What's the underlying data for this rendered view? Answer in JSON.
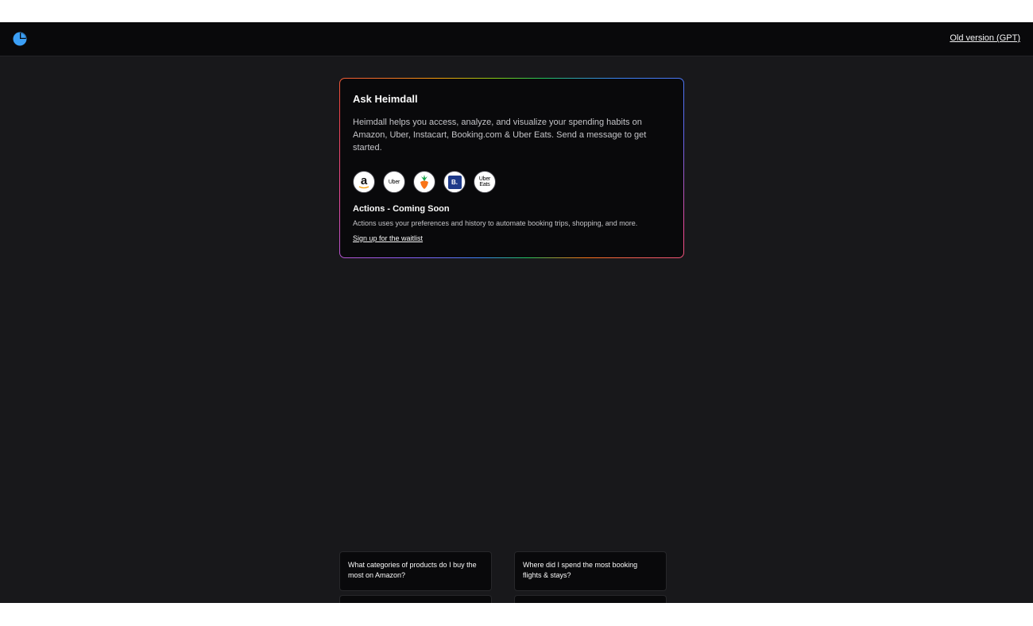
{
  "header": {
    "logo_icon": "pie-chart-icon",
    "old_version_link": "Old version (GPT)"
  },
  "card": {
    "title": "Ask Heimdall",
    "description": "Heimdall helps you access, analyze, and visualize your spending habits on Amazon, Uber, Instacart, Booking.com & Uber Eats. Send a message to get started.",
    "brands": [
      {
        "name": "amazon-icon",
        "glyph": "a"
      },
      {
        "name": "uber-icon",
        "glyph": "Uber"
      },
      {
        "name": "instacart-icon",
        "glyph": ""
      },
      {
        "name": "booking-icon",
        "glyph": "B."
      },
      {
        "name": "uber-eats-icon",
        "glyph": "Uber Eats"
      }
    ],
    "actions_title": "Actions - Coming Soon",
    "actions_description": "Actions uses your preferences and history to automate booking trips, shopping, and more.",
    "waitlist_link": "Sign up for the waitlist"
  },
  "suggestions": [
    "What categories of products do I buy the most on Amazon?",
    "Where did I spend the most booking flights & stays?",
    "",
    ""
  ],
  "colors": {
    "background": "#18181b",
    "topbar": "#09090b",
    "card": "#09090b",
    "accent": "#3b9ff6"
  }
}
